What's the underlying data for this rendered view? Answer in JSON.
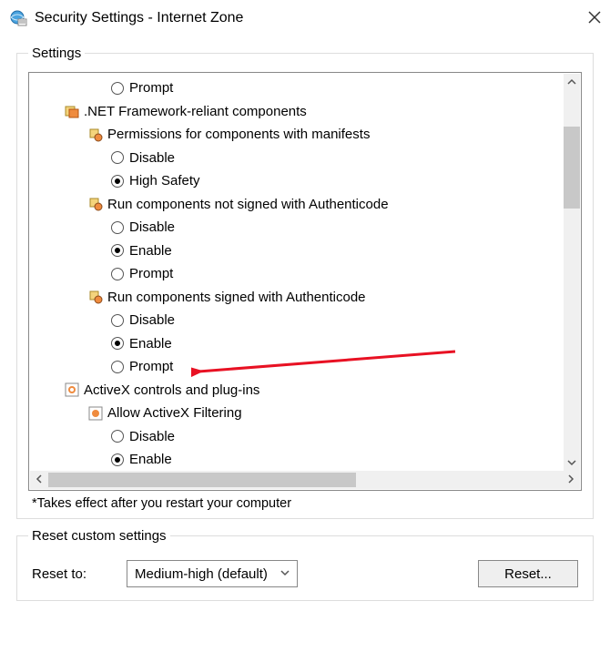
{
  "window": {
    "title": "Security Settings - Internet Zone"
  },
  "settings": {
    "legend": "Settings",
    "note": "*Takes effect after you restart your computer",
    "tree": {
      "prompt0": "Prompt",
      "netfx": ".NET Framework-reliant components",
      "perm_manifests": "Permissions for components with manifests",
      "perm_disable": "Disable",
      "perm_high": "High Safety",
      "run_unsigned": "Run components not signed with Authenticode",
      "ru_disable": "Disable",
      "ru_enable": "Enable",
      "ru_prompt": "Prompt",
      "run_signed": "Run components signed with Authenticode",
      "rs_disable": "Disable",
      "rs_enable": "Enable",
      "rs_prompt": "Prompt",
      "activex": "ActiveX controls and plug-ins",
      "allow_filter": "Allow ActiveX Filtering",
      "af_disable": "Disable",
      "af_enable": "Enable"
    }
  },
  "reset": {
    "legend": "Reset custom settings",
    "label": "Reset to:",
    "value": "Medium-high (default)",
    "button": "Reset..."
  }
}
